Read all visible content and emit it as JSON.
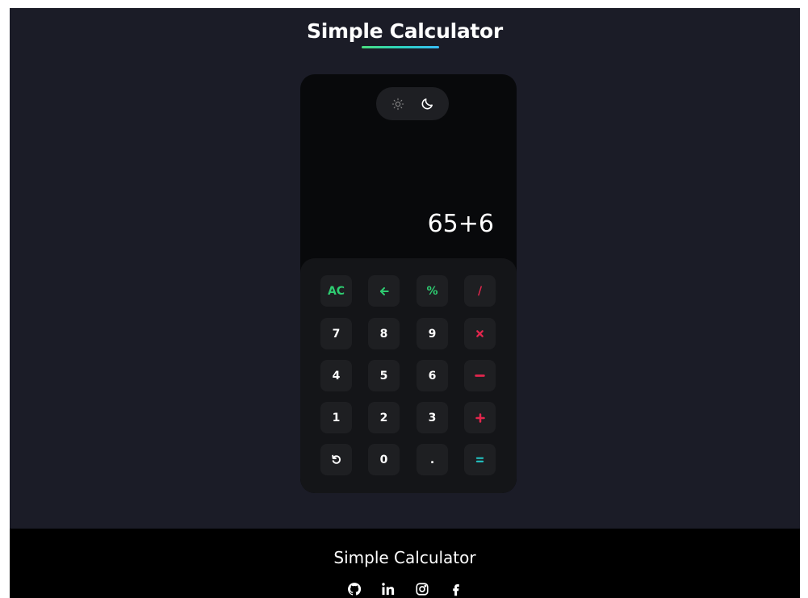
{
  "header": {
    "title": "Simple Calculator"
  },
  "calculator": {
    "display": "65+6",
    "theme": {
      "active": "dark"
    },
    "keys": [
      {
        "label": "AC",
        "color": "#2ecc71",
        "name": "all-clear-button"
      },
      {
        "label": "",
        "icon": "arrow-left-icon",
        "color": "#2ecc71",
        "name": "backspace-button"
      },
      {
        "label": "%",
        "color": "#2ecc71",
        "name": "percent-button"
      },
      {
        "label": "/",
        "color": "#e2264d",
        "name": "divide-button"
      },
      {
        "label": "7",
        "color": "#ffffff",
        "name": "digit-7-button"
      },
      {
        "label": "8",
        "color": "#ffffff",
        "name": "digit-8-button"
      },
      {
        "label": "9",
        "color": "#ffffff",
        "name": "digit-9-button"
      },
      {
        "label": "",
        "icon": "multiply-icon",
        "color": "#e2264d",
        "name": "multiply-button"
      },
      {
        "label": "4",
        "color": "#ffffff",
        "name": "digit-4-button"
      },
      {
        "label": "5",
        "color": "#ffffff",
        "name": "digit-5-button"
      },
      {
        "label": "6",
        "color": "#ffffff",
        "name": "digit-6-button"
      },
      {
        "label": "",
        "icon": "minus-icon",
        "color": "#e2264d",
        "name": "subtract-button"
      },
      {
        "label": "1",
        "color": "#ffffff",
        "name": "digit-1-button"
      },
      {
        "label": "2",
        "color": "#ffffff",
        "name": "digit-2-button"
      },
      {
        "label": "3",
        "color": "#ffffff",
        "name": "digit-3-button"
      },
      {
        "label": "",
        "icon": "plus-icon",
        "color": "#e2264d",
        "name": "add-button"
      },
      {
        "label": "",
        "icon": "undo-icon",
        "color": "#ffffff",
        "name": "undo-button"
      },
      {
        "label": "0",
        "color": "#ffffff",
        "name": "digit-0-button"
      },
      {
        "label": ".",
        "color": "#ffffff",
        "name": "decimal-button"
      },
      {
        "label": "",
        "icon": "equals-icon",
        "color": "#22c3c3",
        "name": "equals-button"
      }
    ]
  },
  "footer": {
    "title": "Simple Calculator",
    "social": [
      "github-icon",
      "linkedin-icon",
      "instagram-icon",
      "facebook-icon"
    ]
  },
  "colors": {
    "background": "#1b1c27",
    "calculator": "#08090b",
    "keypad": "#141518",
    "key": "#1e1f22",
    "accent_green": "#2ecc71",
    "accent_red": "#e2264d",
    "accent_teal": "#22c3c3"
  }
}
